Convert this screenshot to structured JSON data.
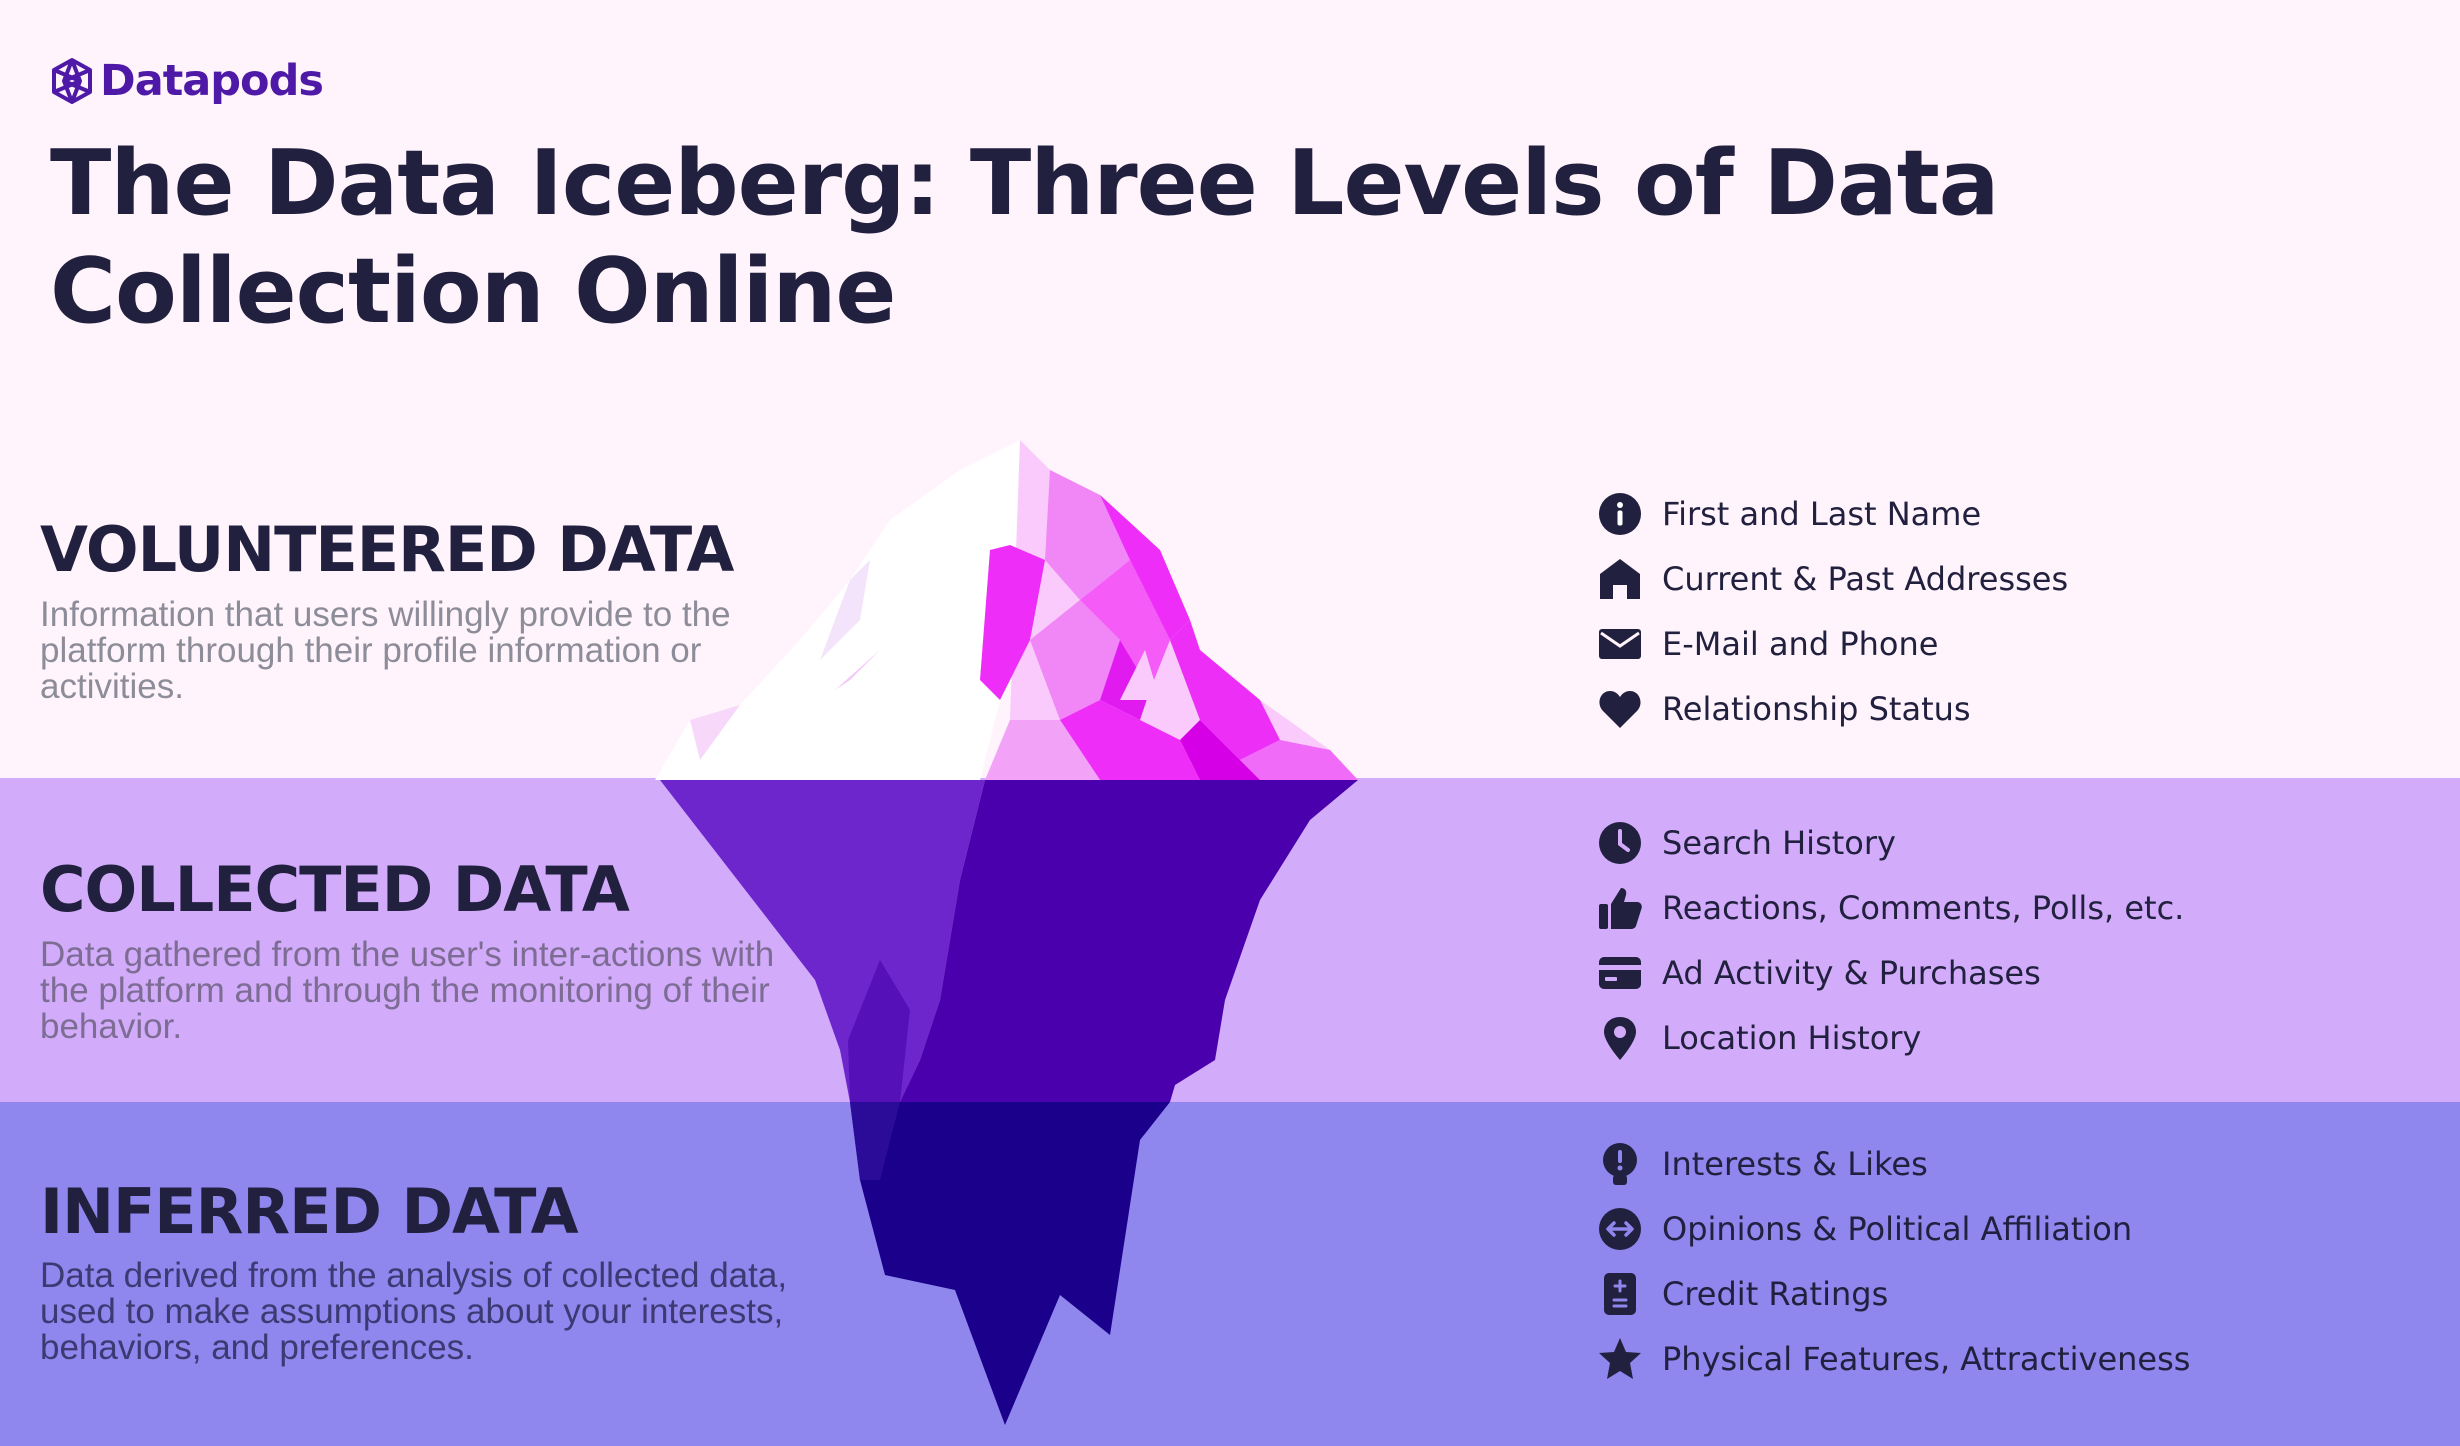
{
  "brand": {
    "name": "Datapods",
    "color": "#4f19a8"
  },
  "title": "The Data Iceberg: Three Levels of Data Collection Online",
  "colors": {
    "background_top": "#fff4fb",
    "background_middle": "#d2acfb",
    "background_bottom": "#8f86ee",
    "text_dark": "#22203f",
    "iceberg_tip_magenta": "#ee2df8",
    "iceberg_mid_purple": "#4a00ac",
    "iceberg_deep_indigo": "#1a008b"
  },
  "levels": [
    {
      "title": "VOLUNTEERED DATA",
      "description": "Information that users willingly provide to the platform through their profile information or activities.",
      "items": [
        {
          "icon": "info-icon",
          "label": "First and Last Name"
        },
        {
          "icon": "home-icon",
          "label": "Current & Past Addresses"
        },
        {
          "icon": "mail-icon",
          "label": "E-Mail and Phone"
        },
        {
          "icon": "heart-icon",
          "label": "Relationship Status"
        }
      ]
    },
    {
      "title": "COLLECTED DATA",
      "description": "Data gathered from the user's inter-actions with the platform and through the monitoring of their behavior.",
      "items": [
        {
          "icon": "clock-icon",
          "label": "Search History"
        },
        {
          "icon": "thumbs-up-icon",
          "label": "Reactions, Comments, Polls, etc."
        },
        {
          "icon": "credit-card-icon",
          "label": "Ad Activity & Purchases"
        },
        {
          "icon": "location-pin-icon",
          "label": "Location History"
        }
      ]
    },
    {
      "title": "INFERRED DATA",
      "description": "Data derived from the analysis of collected data, used to make assumptions about your interests, behaviors, and preferences.",
      "items": [
        {
          "icon": "lightbulb-icon",
          "label": "Interests & Likes"
        },
        {
          "icon": "swap-arrows-icon",
          "label": "Opinions & Political Affiliation"
        },
        {
          "icon": "calculator-icon",
          "label": "Credit Ratings"
        },
        {
          "icon": "star-icon",
          "label": "Physical Features, Attractiveness"
        }
      ]
    }
  ]
}
